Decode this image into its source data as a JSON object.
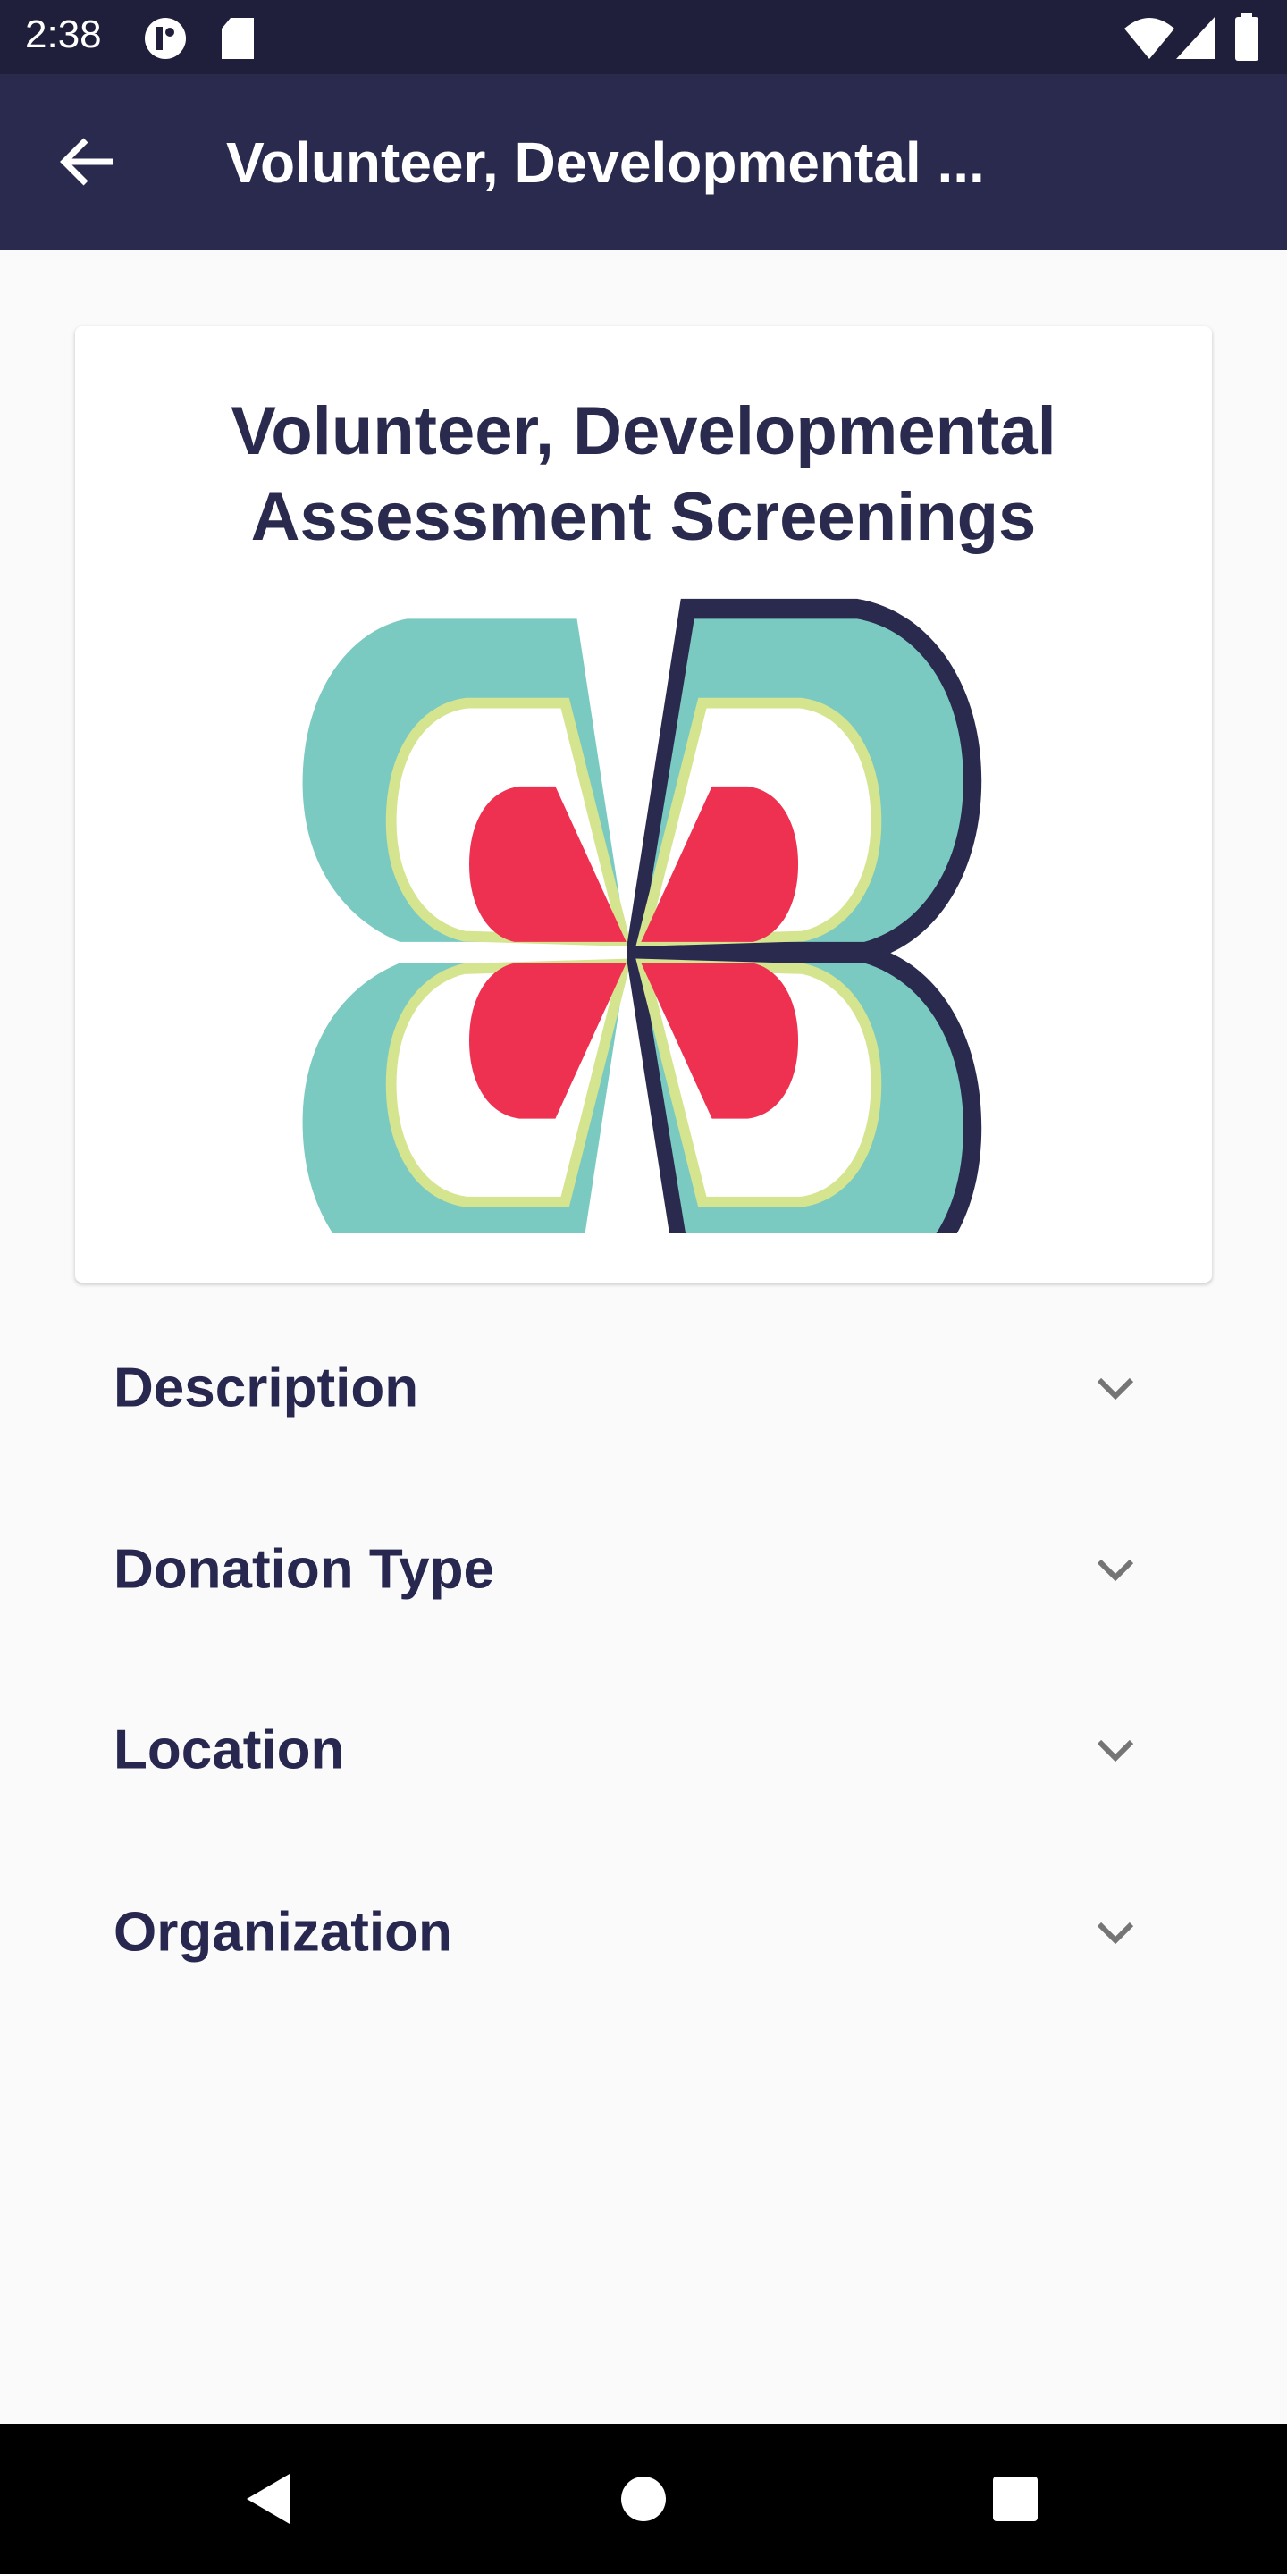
{
  "status_bar": {
    "time": "2:38"
  },
  "app_bar": {
    "title": "Volunteer, Developmental ..."
  },
  "card": {
    "title_line1": "Volunteer, Developmental",
    "title_line2": "Assessment Screenings"
  },
  "sections": [
    {
      "label": "Description"
    },
    {
      "label": "Donation Type"
    },
    {
      "label": "Location"
    },
    {
      "label": "Organization"
    }
  ],
  "colors": {
    "primary": "#2a2a4e",
    "teal": "#7acac2",
    "red": "#ee3150",
    "green": "#d5e48f"
  }
}
